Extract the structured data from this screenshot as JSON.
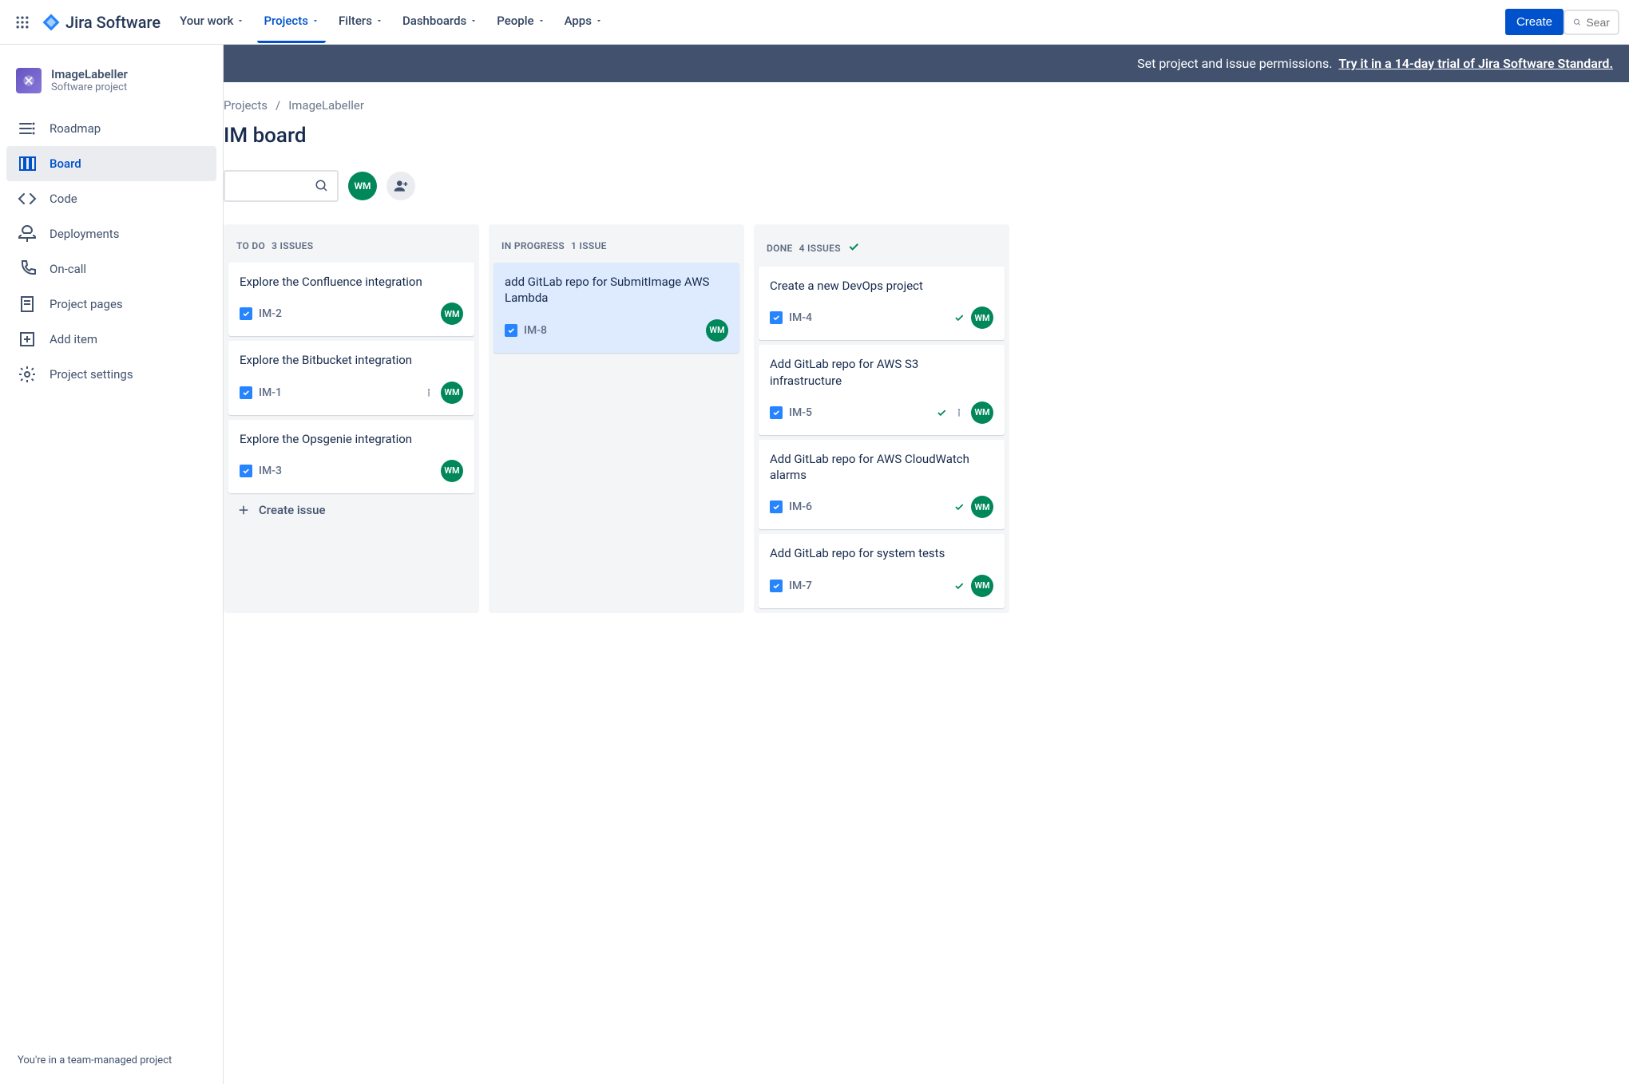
{
  "topnav": {
    "brand": "Jira Software",
    "items": [
      {
        "label": "Your work",
        "active": false
      },
      {
        "label": "Projects",
        "active": true
      },
      {
        "label": "Filters",
        "active": false
      },
      {
        "label": "Dashboards",
        "active": false
      },
      {
        "label": "People",
        "active": false
      },
      {
        "label": "Apps",
        "active": false
      }
    ],
    "create": "Create",
    "search_placeholder": "Sear"
  },
  "sidebar": {
    "project_name": "ImageLabeller",
    "project_sub": "Software project",
    "items": [
      {
        "label": "Roadmap",
        "icon": "roadmap",
        "active": false
      },
      {
        "label": "Board",
        "icon": "board",
        "active": true
      },
      {
        "label": "Code",
        "icon": "code",
        "active": false
      },
      {
        "label": "Deployments",
        "icon": "deploy",
        "active": false
      },
      {
        "label": "On-call",
        "icon": "oncall",
        "active": false
      },
      {
        "label": "Project pages",
        "icon": "pages",
        "active": false
      },
      {
        "label": "Add item",
        "icon": "add",
        "active": false
      },
      {
        "label": "Project settings",
        "icon": "settings",
        "active": false
      }
    ],
    "footer": "You're in a team-managed project"
  },
  "banner": {
    "text": "Set project and issue permissions.",
    "link": "Try it in a 14-day trial of Jira Software Standard."
  },
  "breadcrumb": [
    "Projects",
    "ImageLabeller"
  ],
  "page_title": "IM board",
  "avatar_initials": "WM",
  "columns": [
    {
      "name": "TO DO",
      "count": "3 ISSUES",
      "done": false,
      "cards": [
        {
          "title": "Explore the Confluence integration",
          "key": "IM-2",
          "assignee": "WM",
          "priority": false,
          "done": false,
          "selected": false
        },
        {
          "title": "Explore the Bitbucket integration",
          "key": "IM-1",
          "assignee": "WM",
          "priority": true,
          "done": false,
          "selected": false
        },
        {
          "title": "Explore the Opsgenie integration",
          "key": "IM-3",
          "assignee": "WM",
          "priority": false,
          "done": false,
          "selected": false
        }
      ],
      "create_label": "Create issue"
    },
    {
      "name": "IN PROGRESS",
      "count": "1 ISSUE",
      "done": false,
      "cards": [
        {
          "title": "add GitLab repo for SubmitImage AWS Lambda",
          "key": "IM-8",
          "assignee": "WM",
          "priority": false,
          "done": false,
          "selected": true
        }
      ]
    },
    {
      "name": "DONE",
      "count": "4 ISSUES",
      "done": true,
      "cards": [
        {
          "title": "Create a new DevOps project",
          "key": "IM-4",
          "assignee": "WM",
          "priority": false,
          "done": true,
          "selected": false
        },
        {
          "title": "Add GitLab repo for AWS S3 infrastructure",
          "key": "IM-5",
          "assignee": "WM",
          "priority": true,
          "done": true,
          "selected": false
        },
        {
          "title": "Add GitLab repo for AWS CloudWatch alarms",
          "key": "IM-6",
          "assignee": "WM",
          "priority": false,
          "done": true,
          "selected": false
        },
        {
          "title": "Add GitLab repo for system tests",
          "key": "IM-7",
          "assignee": "WM",
          "priority": false,
          "done": true,
          "selected": false
        }
      ]
    }
  ]
}
